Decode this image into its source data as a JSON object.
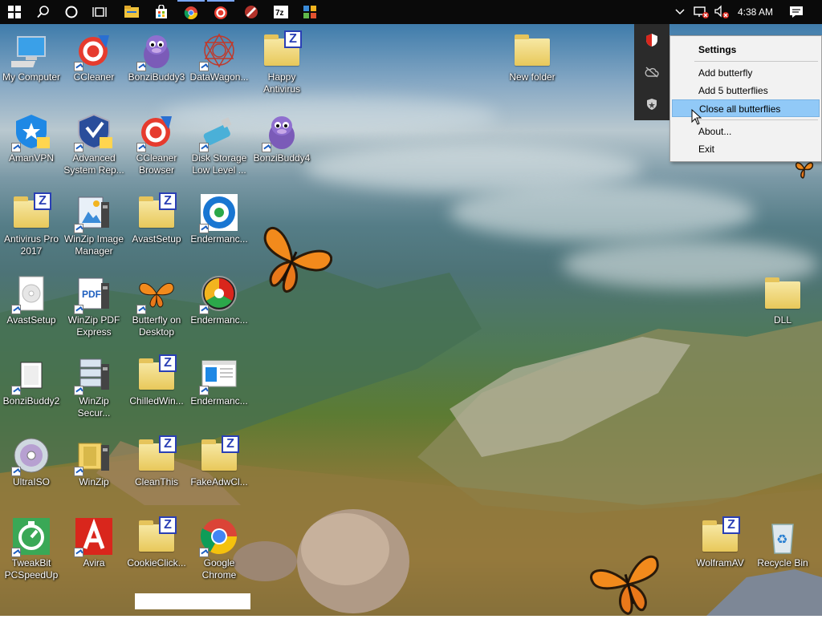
{
  "taskbar": {
    "clock": "4:38 AM",
    "apps": [
      "file-explorer",
      "store",
      "chrome",
      "ccleaner",
      "ccleaner-browser",
      "7zip",
      "control-panel"
    ]
  },
  "desktop_icons": [
    {
      "name": "My Computer",
      "kind": "computer"
    },
    {
      "name": "CCleaner",
      "kind": "ccleaner"
    },
    {
      "name": "BonziBuddy3",
      "kind": "bonzi"
    },
    {
      "name": "DataWagon...",
      "kind": "datawagon"
    },
    {
      "name": "Happy Antivirus",
      "kind": "zipfolder"
    },
    {
      "name": "AmanVPN",
      "kind": "vpn"
    },
    {
      "name": "Advanced System Rep...",
      "kind": "shield"
    },
    {
      "name": "CCleaner Browser",
      "kind": "ccleaner"
    },
    {
      "name": "Disk Storage Low Level ...",
      "kind": "usb"
    },
    {
      "name": "BonziBuddy4",
      "kind": "bonzi"
    },
    {
      "name": "Antivirus Pro 2017",
      "kind": "zipfolder"
    },
    {
      "name": "WinZip Image Manager",
      "kind": "image"
    },
    {
      "name": "AvastSetup",
      "kind": "zipfolder"
    },
    {
      "name": "Endermanc...",
      "kind": "enderman"
    },
    {
      "name": "AvastSetup",
      "kind": "disc-file"
    },
    {
      "name": "WinZip PDF Express",
      "kind": "pdf"
    },
    {
      "name": "Butterfly on Desktop",
      "kind": "butterfly"
    },
    {
      "name": "Endermanc...",
      "kind": "gauge"
    },
    {
      "name": "BonziBuddy2",
      "kind": "bonzi2"
    },
    {
      "name": "WinZip Secur...",
      "kind": "server"
    },
    {
      "name": "ChilledWin...",
      "kind": "zipfolder"
    },
    {
      "name": "Endermanc...",
      "kind": "window"
    },
    {
      "name": "UltraISO",
      "kind": "cd"
    },
    {
      "name": "WinZip",
      "kind": "winzip"
    },
    {
      "name": "CleanThis",
      "kind": "zipfolder"
    },
    {
      "name": "FakeAdwCl...",
      "kind": "zipfolder"
    },
    {
      "name": "TweakBit PCSpeedUp",
      "kind": "tweakbit"
    },
    {
      "name": "Avira",
      "kind": "avira"
    },
    {
      "name": "CookieClick...",
      "kind": "zipfolder"
    },
    {
      "name": "Google Chrome",
      "kind": "chrome"
    },
    {
      "name": "New folder",
      "kind": "folder"
    },
    {
      "name": "DLL",
      "kind": "folder"
    },
    {
      "name": "WolframAV",
      "kind": "zipfolder"
    },
    {
      "name": "Recycle Bin",
      "kind": "recycle"
    }
  ],
  "tray_flyout": {
    "icons": [
      "shield-icon",
      "network-off-icon",
      "security-icon"
    ]
  },
  "context_menu": {
    "items": [
      {
        "label": "Settings",
        "bold": true
      },
      {
        "label": "Add butterfly"
      },
      {
        "label": "Add 5 butterflies"
      },
      {
        "label": "Close all butterflies",
        "highlighted": true
      },
      {
        "label": "About..."
      },
      {
        "label": "Exit"
      }
    ]
  },
  "colors": {
    "taskbar": "#0a0a0a",
    "menu_highlight": "#91c9f7",
    "zip_blue": "#2a3fb5"
  }
}
